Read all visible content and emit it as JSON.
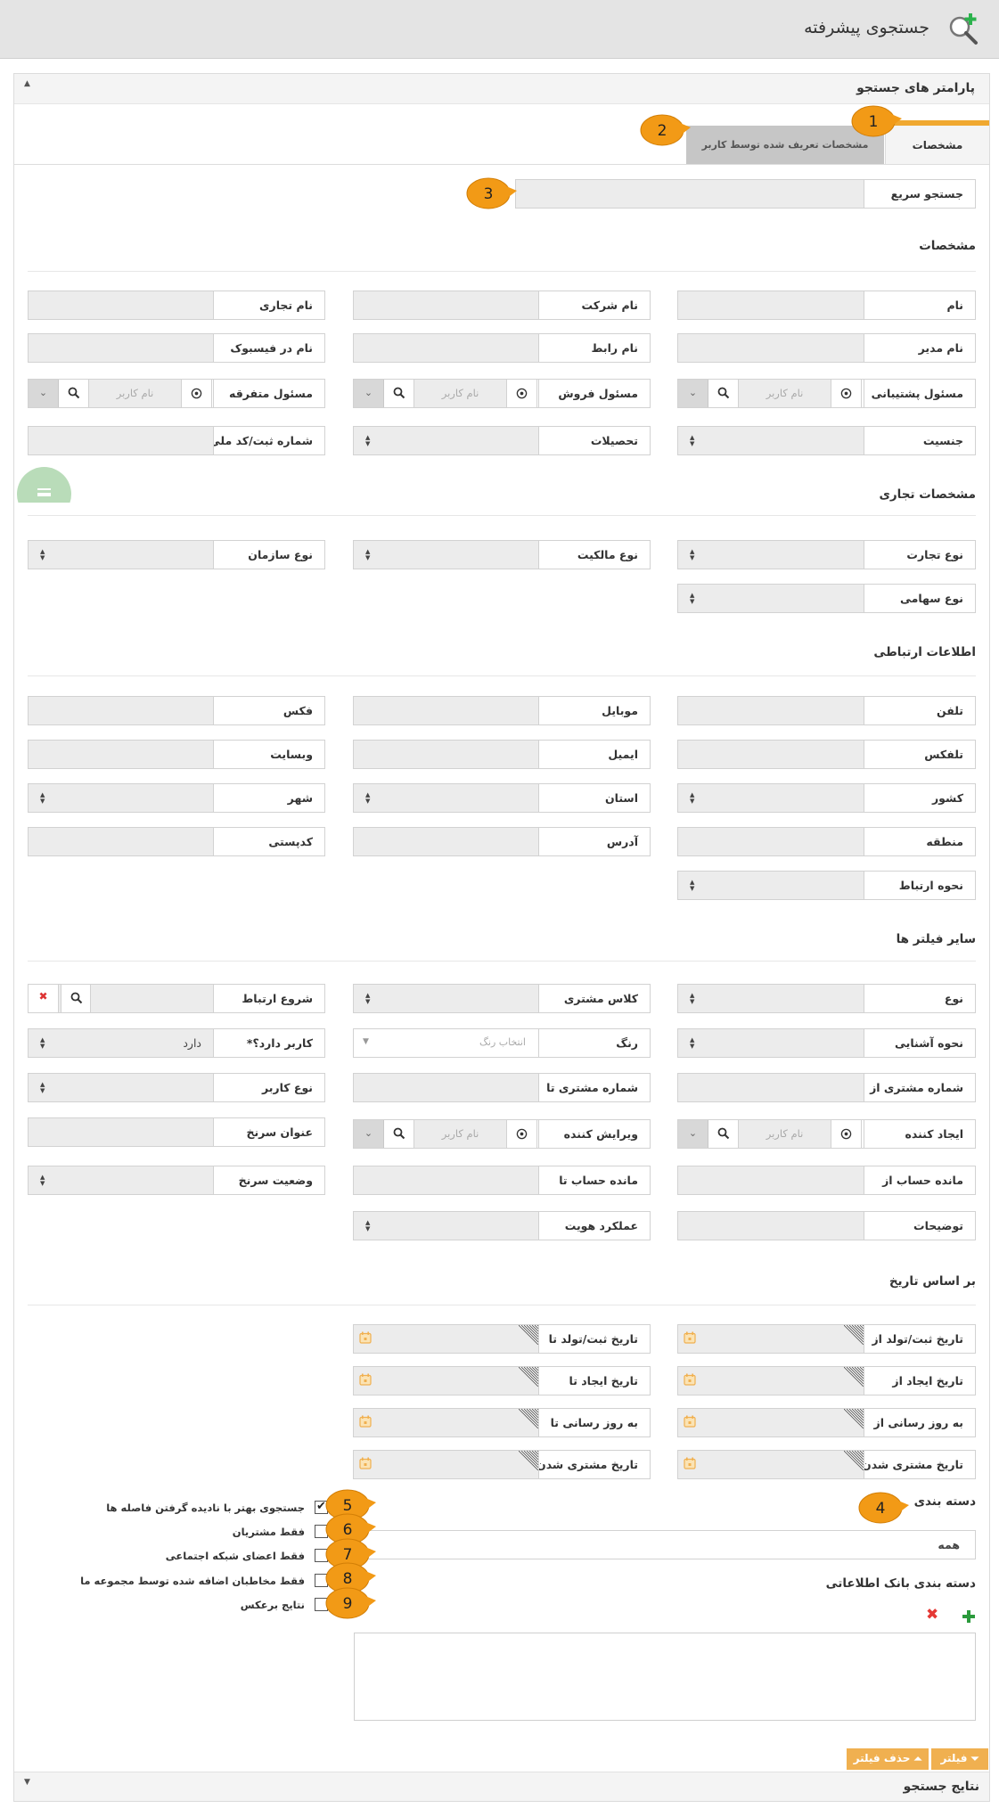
{
  "page": {
    "title": "جستجوی پیشرفته"
  },
  "panel": {
    "title": "پارامتر های جستجو",
    "results_title": "نتایج جستجو"
  },
  "tabs": {
    "details": "مشخصات",
    "custom": "مشخصات تعریف شده توسط کاربر"
  },
  "quick_search": {
    "label": "جستجو سریع",
    "value": ""
  },
  "sections": {
    "details": "مشخصات",
    "business": "مشخصات تجاری",
    "contact": "اطلاعات ارتباطی",
    "other_filters": "سایر فیلتر ها",
    "by_date": "بر اساس تاریخ",
    "category": "دسته بندی",
    "db_category": "دسته بندی بانک اطلاعاتی"
  },
  "fields": {
    "name": "نام",
    "company_name": "نام شرکت",
    "trade_name": "نام تجاری",
    "manager_name": "نام مدیر",
    "liaison_name": "نام رابط",
    "facebook_name": "نام در فیسبوک",
    "support_owner": "مسئول پشتیبانی",
    "sales_owner": "مسئول فروش",
    "misc_owner": "مسئول متفرقه",
    "gender": "جنسیت",
    "education": "تحصیلات",
    "reg_id": "شماره ثبت/کد ملی",
    "business_type": "نوع تجارت",
    "ownership_type": "نوع مالکیت",
    "org_type": "نوع سازمان",
    "share_type": "نوع سهامی",
    "phone": "تلفن",
    "mobile": "موبایل",
    "fax": "فکس",
    "telex": "تلفکس",
    "email": "ایمیل",
    "website": "وبسایت",
    "country": "کشور",
    "province": "استان",
    "city": "شهر",
    "region": "منطقه",
    "address": "آدرس",
    "postal_code": "کدپستی",
    "contact_method": "نحوه ارتباط",
    "type": "نوع",
    "customer_class": "کلاس مشتری",
    "contact_start": "شروع ارتباط",
    "acquaintance": "نحوه آشنایی",
    "color": "رنگ",
    "has_user": "کاربر دارد؟*",
    "cust_no_from": "شماره مشتری از",
    "cust_no_to": "شماره مشتری تا",
    "user_type": "نوع کاربر",
    "creator": "ایجاد کننده",
    "editor": "ویرایش کننده",
    "rate_title": "عنوان سرنخ",
    "balance_from": "مانده حساب از",
    "balance_to": "مانده حساب تا",
    "rate_status": "وضعیت سرنخ",
    "description": "توضیحات",
    "identity_func": "عملکرد هویت",
    "reg_date_from": "تاریخ ثبت/تولد از",
    "reg_date_to": "تاریخ ثبت/تولد تا",
    "create_date_from": "تاریخ ایجاد از",
    "create_date_to": "تاریخ ایجاد تا",
    "update_from": "به روز رسانی از",
    "update_to": "به روز رسانی تا",
    "customer_date_from": "تاریخ مشتری شدن از",
    "customer_date_to": "تاریخ مشتری شدن تا"
  },
  "placeholders": {
    "username": "نام کاربر",
    "color": "انتخاب رنگ"
  },
  "values": {
    "has_user": "دارد",
    "category": "همه"
  },
  "options": {
    "fuzzy": "جستجوی بهتر با نادیده گرفتن فاصله ها",
    "customers_only": "فقط مشتریان",
    "social_only": "فقط اعضای شبکه اجتماعی",
    "ours_only": "فقط مخاطبان اضافه شده توسط مجموعه ما",
    "reverse": "نتایج برعکس"
  },
  "checked": {
    "fuzzy": true,
    "customers_only": false,
    "social_only": false,
    "ours_only": false,
    "reverse": false
  },
  "buttons": {
    "filter": "فیلتر",
    "remove_filter": "حذف فیلتر"
  },
  "callouts": [
    "1",
    "2",
    "3",
    "4",
    "5",
    "6",
    "7",
    "8",
    "9"
  ],
  "colors": {
    "accent": "#f0a830",
    "callout": "#f29a16",
    "field_bg": "#ececec",
    "green": "#7cc27f",
    "red": "#e53935",
    "button": "#f0b050"
  }
}
